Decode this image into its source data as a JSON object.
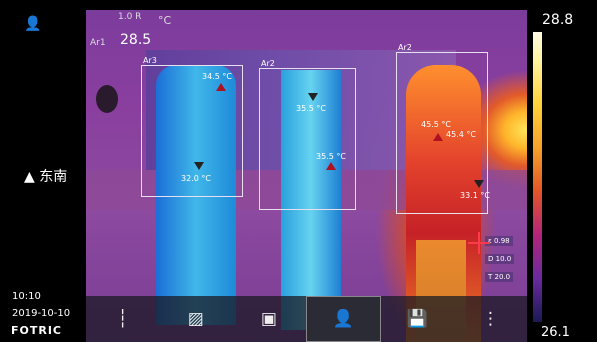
{
  "overlay": {
    "small_top": "1.0 R",
    "small_top2": "Ar1",
    "unit": "°C",
    "emissivity_line": "0.98",
    "main_temp": "28.5"
  },
  "colorbar": {
    "max": "28.8",
    "min": "26.1"
  },
  "left": {
    "compass": "▲ 东南",
    "time": "10:10",
    "date": "2019-10-10",
    "brand": "FOTRIC"
  },
  "rois": [
    {
      "label": "Ar3"
    },
    {
      "label": "Ar2"
    },
    {
      "label": "Ar2"
    }
  ],
  "spots": [
    {
      "text": "34.5 °C"
    },
    {
      "text": "32.0 °C"
    },
    {
      "text": "35.5 °C"
    },
    {
      "text": "35.5 °C"
    },
    {
      "text": "45.5 °C"
    },
    {
      "text": "45.4 °C"
    },
    {
      "text": "33.1 °C"
    }
  ],
  "readouts": [
    "ε 0.98",
    "D 10.0",
    "T 20.0"
  ],
  "toolbar": [
    {
      "icon": "┆",
      "name": "level-span-button"
    },
    {
      "icon": "▨",
      "name": "roi-tool-button"
    },
    {
      "icon": "▣",
      "name": "video-button"
    },
    {
      "icon": "👤",
      "name": "person-mode-button"
    },
    {
      "icon": "💾",
      "name": "save-button"
    },
    {
      "icon": "⋮",
      "name": "more-menu-button"
    }
  ]
}
